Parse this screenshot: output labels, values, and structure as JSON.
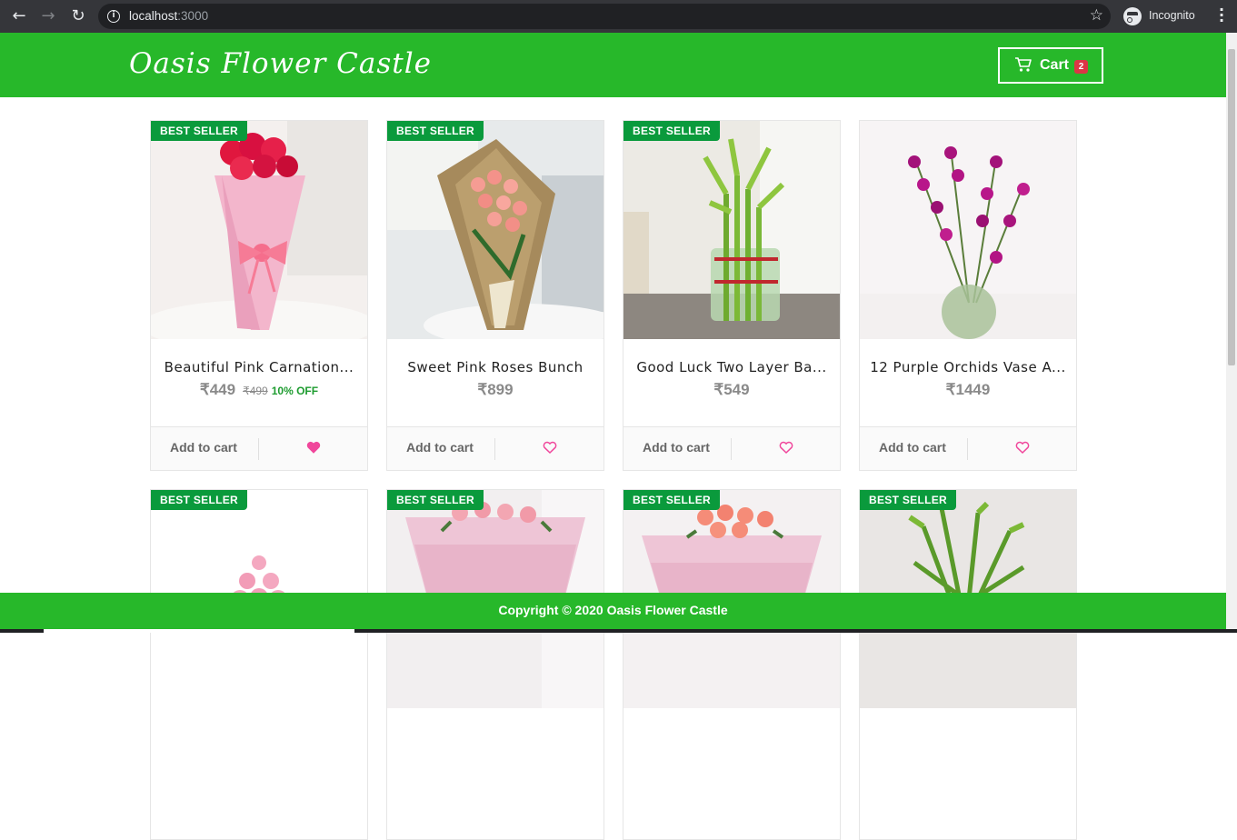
{
  "browser": {
    "url_host": "localhost",
    "url_port": ":3000",
    "profile_label": "Incognito"
  },
  "header": {
    "logo": "Oasis Flower Castle",
    "cart_label": "Cart",
    "cart_count": "2"
  },
  "products": [
    {
      "name": "Beautiful Pink Carnation...",
      "price": "₹449",
      "old_price": "₹499",
      "discount": "10% OFF",
      "badge": "BEST SELLER",
      "add_label": "Add to cart",
      "liked": true,
      "image": "pink carnation bouquet"
    },
    {
      "name": "Sweet Pink Roses Bunch",
      "price": "₹899",
      "old_price": "",
      "discount": "",
      "badge": "BEST SELLER",
      "add_label": "Add to cart",
      "liked": false,
      "image": "pink roses in jute wrap"
    },
    {
      "name": "Good Luck Two Layer Ba...",
      "price": "₹549",
      "old_price": "",
      "discount": "",
      "badge": "BEST SELLER",
      "add_label": "Add to cart",
      "liked": false,
      "image": "lucky bamboo in glass vase"
    },
    {
      "name": "12 Purple Orchids Vase A...",
      "price": "₹1449",
      "old_price": "",
      "discount": "",
      "badge": "BEST SELLER",
      "add_label": "Add to cart",
      "liked": false,
      "image": "purple orchids in round vase"
    },
    {
      "name": "",
      "price": "",
      "old_price": "",
      "discount": "",
      "badge": "BEST SELLER",
      "add_label": "",
      "liked": false,
      "image": "pink roses tower"
    },
    {
      "name": "",
      "price": "",
      "old_price": "",
      "discount": "",
      "badge": "BEST SELLER",
      "add_label": "",
      "liked": false,
      "image": "pink roses in pink wrap"
    },
    {
      "name": "",
      "price": "",
      "old_price": "",
      "discount": "",
      "badge": "BEST SELLER",
      "add_label": "",
      "liked": false,
      "image": "peach roses in pink wrap"
    },
    {
      "name": "",
      "price": "",
      "old_price": "",
      "discount": "",
      "badge": "BEST SELLER",
      "add_label": "",
      "liked": false,
      "image": "lucky bamboo plant"
    }
  ],
  "footer": {
    "text": "Copyright © 2020 Oasis Flower Castle"
  },
  "colors": {
    "brand_green": "#27b82a",
    "badge_green": "#0a9a3c",
    "heart_pink": "#f0469b",
    "cart_badge_red": "#dc3545"
  }
}
